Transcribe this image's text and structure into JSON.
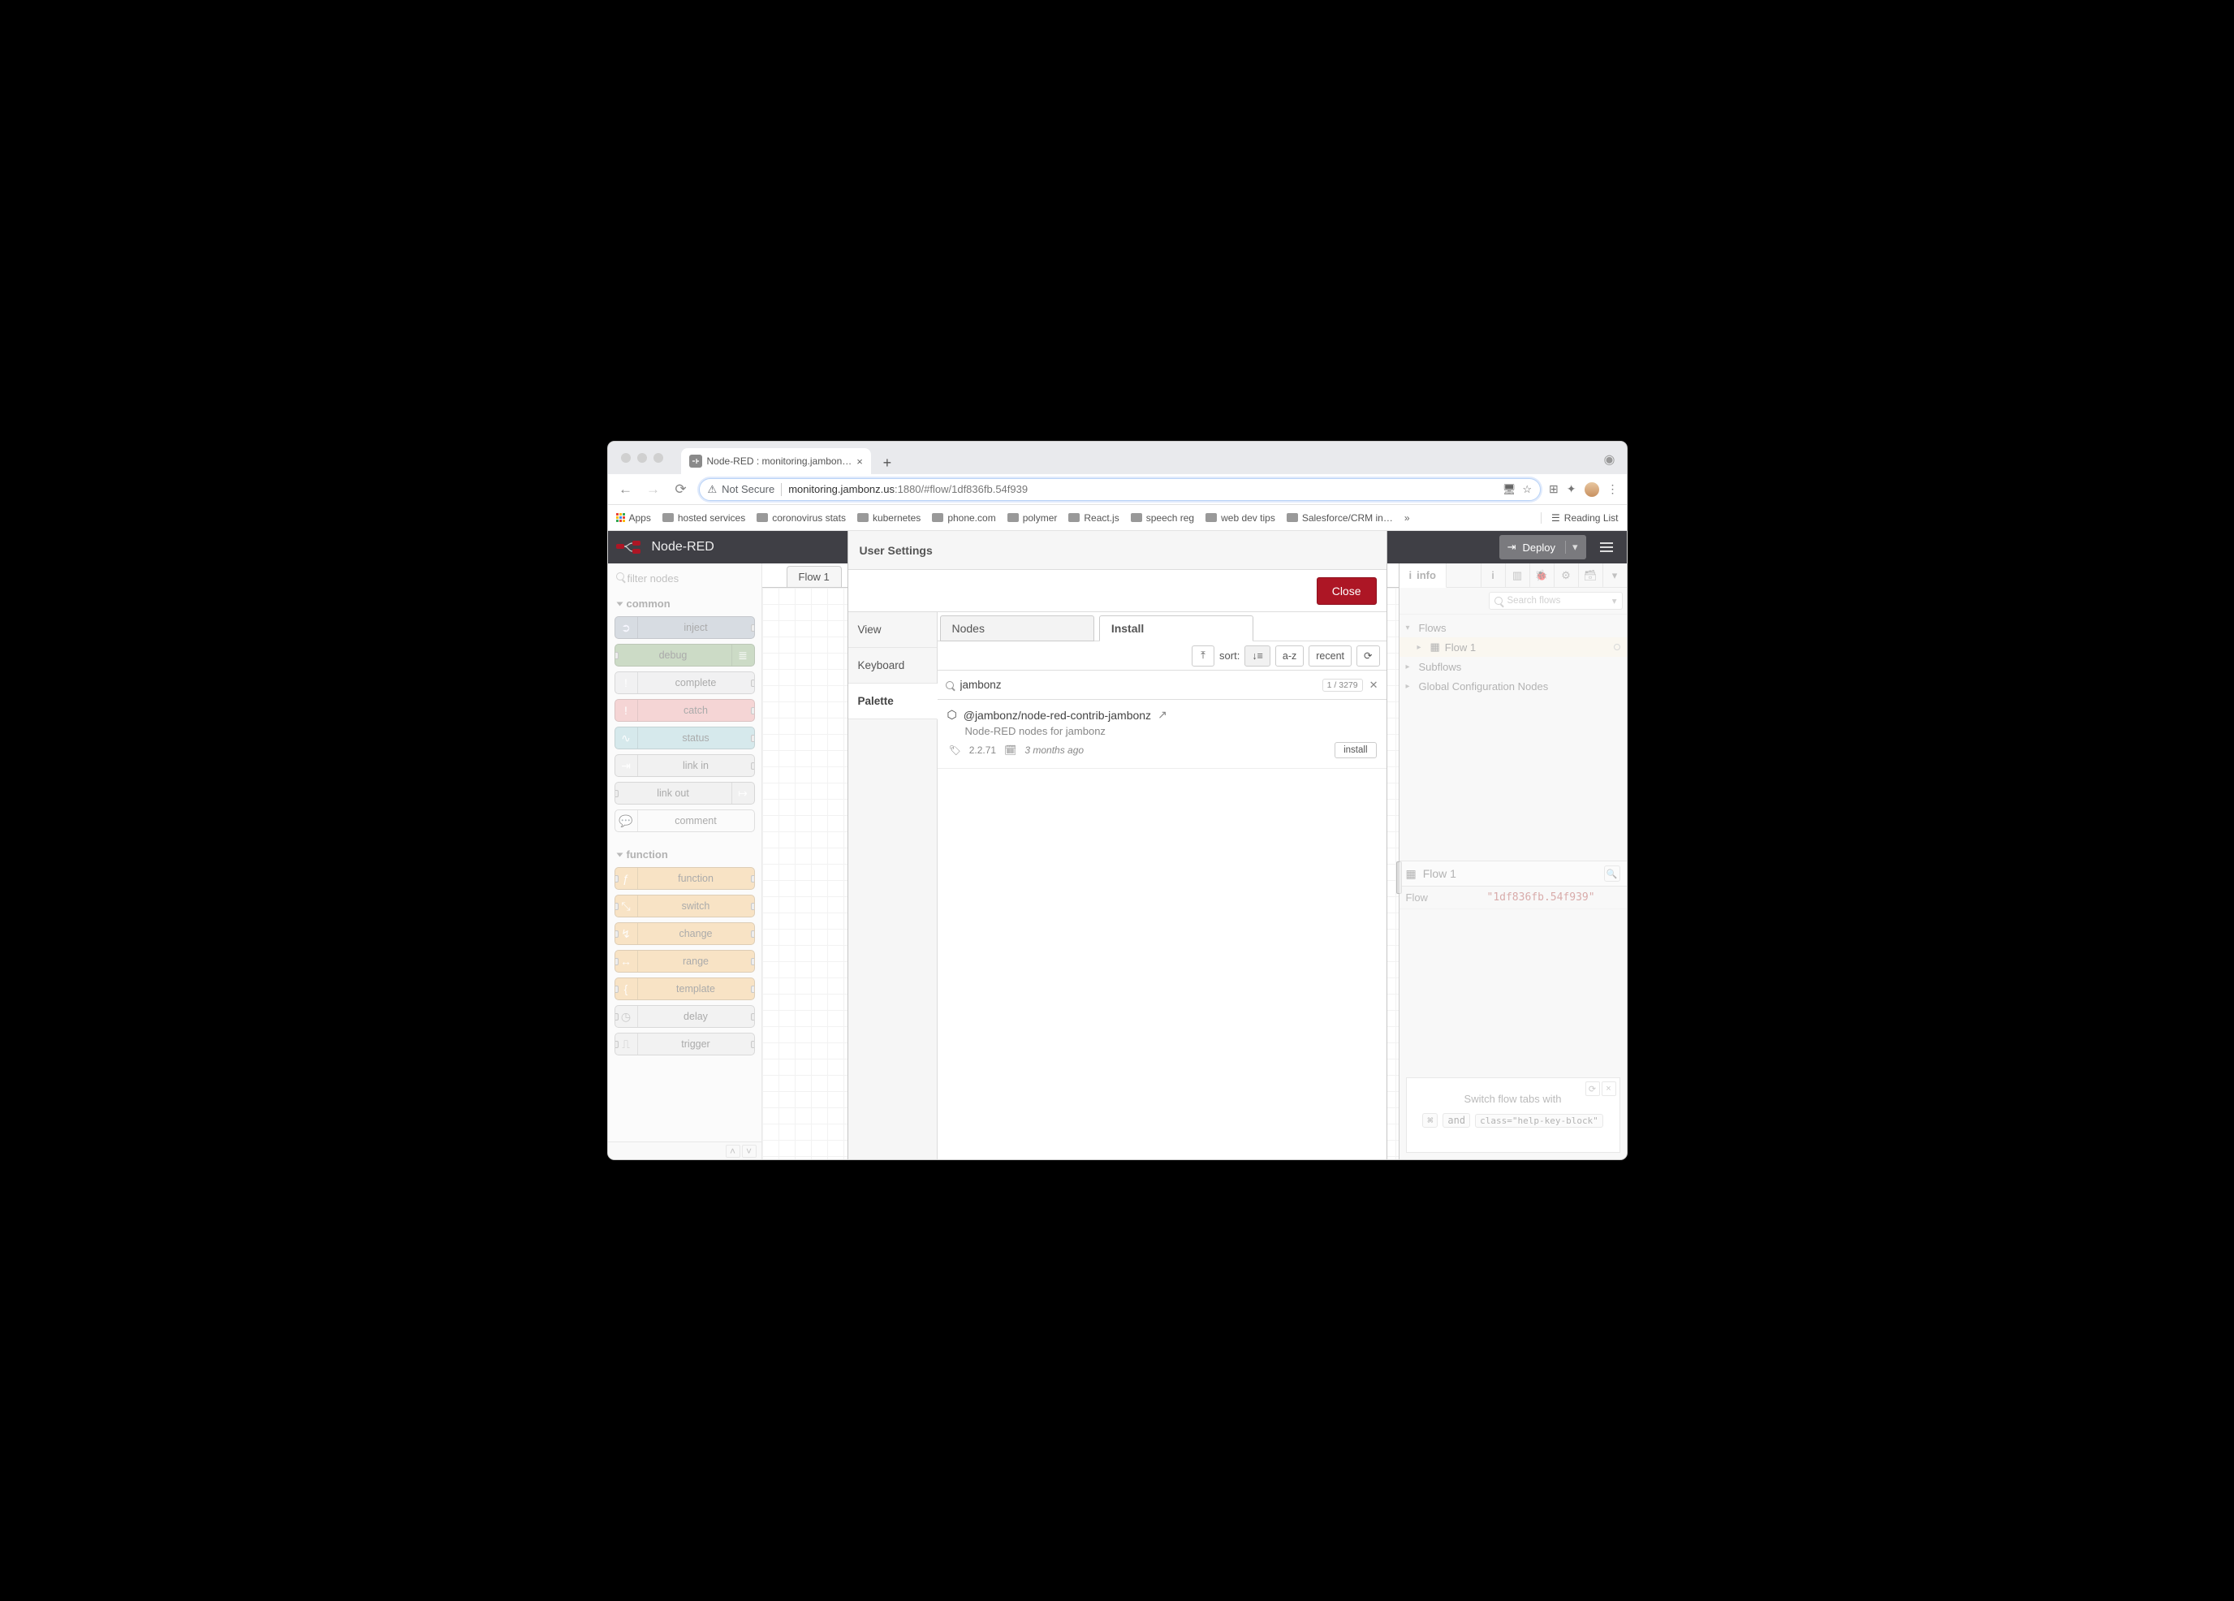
{
  "browser": {
    "tab_title": "Node-RED : monitoring.jambon…",
    "url_host": "monitoring.jambonz.us",
    "url_port_path": ":1880/#flow/1df836fb.54f939",
    "security": "Not Secure",
    "new_tab": "+",
    "bookmarks": [
      "Apps",
      "hosted services",
      "coronovirus stats",
      "kubernetes",
      "phone.com",
      "polymer",
      "React.js",
      "speech reg",
      "web dev tips",
      "Salesforce/CRM in…"
    ],
    "reading_list": "Reading List"
  },
  "nodered": {
    "title": "Node-RED",
    "deploy": "Deploy",
    "palette_filter_placeholder": "filter nodes",
    "categories": {
      "common": {
        "label": "common",
        "nodes": [
          "inject",
          "debug",
          "complete",
          "catch",
          "status",
          "link in",
          "link out",
          "comment"
        ]
      },
      "function": {
        "label": "function",
        "nodes": [
          "function",
          "switch",
          "change",
          "range",
          "template",
          "delay",
          "trigger"
        ]
      }
    },
    "workspace_tab": "Flow 1"
  },
  "sidebar": {
    "info_tab": "info",
    "search_placeholder": "Search flows",
    "tree": {
      "flows": "Flows",
      "flow1": "Flow 1",
      "subflows": "Subflows",
      "global": "Global Configuration Nodes"
    },
    "flow_panel_title": "Flow 1",
    "prop_key": "Flow",
    "prop_val": "\"1df836fb.54f939\"",
    "tip_line": "Switch flow tabs with",
    "tip_keys": [
      "⌘",
      "and",
      "class=\"help-key-block\""
    ]
  },
  "dialog": {
    "title": "User Settings",
    "close": "Close",
    "nav": [
      "View",
      "Keyboard",
      "Palette"
    ],
    "tabs": {
      "nodes": "Nodes",
      "install": "Install"
    },
    "toolbar": {
      "sort_label": "sort:",
      "az": "a-z",
      "recent": "recent"
    },
    "search_value": "jambonz",
    "count": "1 / 3279",
    "result": {
      "name": "@jambonz/node-red-contrib-jambonz",
      "desc": "Node-RED nodes for jambonz",
      "version": "2.2.71",
      "age": "3 months ago",
      "install": "install"
    }
  }
}
